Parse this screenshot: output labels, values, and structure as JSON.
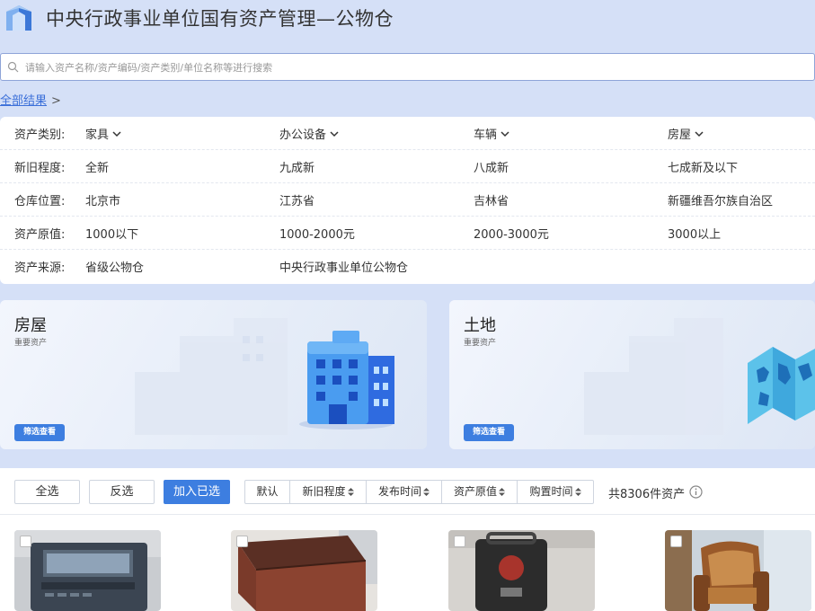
{
  "header": {
    "title": "中央行政事业单位国有资产管理—公物仓",
    "logo_icon": "building-logo-icon"
  },
  "search": {
    "placeholder": "请输入资产名称/资产编码/资产类别/单位名称等进行搜索"
  },
  "breadcrumb": {
    "root": "全部结果",
    "separator": ">"
  },
  "filters": [
    {
      "label": "资产类别:",
      "options": [
        "家具",
        "办公设备",
        "车辆",
        "房屋"
      ],
      "dropdown": true
    },
    {
      "label": "新旧程度:",
      "options": [
        "全新",
        "九成新",
        "八成新",
        "七成新及以下"
      ],
      "dropdown": false
    },
    {
      "label": "仓库位置:",
      "options": [
        "北京市",
        "江苏省",
        "吉林省",
        "新疆维吾尔族自治区"
      ],
      "dropdown": false
    },
    {
      "label": "资产原值:",
      "options": [
        "1000以下",
        "1000-2000元",
        "2000-3000元",
        "3000以上"
      ],
      "dropdown": false
    },
    {
      "label": "资产来源:",
      "options": [
        "省级公物仓",
        "中央行政事业单位公物仓"
      ],
      "dropdown": false
    }
  ],
  "cards": [
    {
      "title": "房屋",
      "subtitle": "重要资产",
      "button": "筛选查看",
      "icon": "building-icon"
    },
    {
      "title": "土地",
      "subtitle": "重要资产",
      "button": "筛选查看",
      "icon": "map-icon"
    }
  ],
  "toolbar": {
    "select_all": "全选",
    "invert": "反选",
    "add_selected": "加入已选",
    "sorts": [
      "默认",
      "新旧程度",
      "发布时间",
      "资产原值",
      "购置时间"
    ],
    "count": "共8306件资产"
  },
  "products": [
    {
      "icon": "shredder-machine-icon"
    },
    {
      "icon": "wooden-desk-icon"
    },
    {
      "icon": "battery-device-icon"
    },
    {
      "icon": "armchair-icon"
    }
  ],
  "colors": {
    "accent": "#3d7ee0",
    "page_bg": "#d5e0f7",
    "link": "#3b6fd9"
  }
}
